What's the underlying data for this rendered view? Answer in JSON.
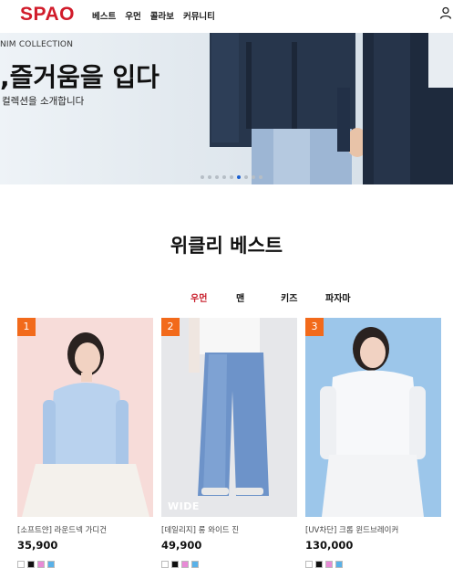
{
  "header": {
    "logo": "SPAO",
    "nav": [
      "베스트",
      "우먼",
      "콜라보",
      "커뮤니티"
    ]
  },
  "hero": {
    "subtitle": "NIM COLLECTION",
    "title": ",즐거움을 입다",
    "description": "컬렉션을 소개합니다",
    "slide_count": 9,
    "active_slide_index": 5
  },
  "weekly_best": {
    "title": "위클리 베스트",
    "tabs": [
      "우먼",
      "맨",
      "키즈",
      "파자마"
    ],
    "active_tab": "우먼"
  },
  "products": [
    {
      "rank": "1",
      "name": "[소프트얀] 라운드넥 가디건",
      "price": "35,900",
      "overlay": "",
      "swatches": [
        "#ffffff",
        "#111111",
        "#e88ad6",
        "#59b1e8"
      ]
    },
    {
      "rank": "2",
      "name": "[데일리지] 롱 와이드 진",
      "price": "49,900",
      "overlay": "WIDE",
      "swatches": [
        "#ffffff",
        "#111111",
        "#e88ad6",
        "#59b1e8"
      ]
    },
    {
      "rank": "3",
      "name": "[UV차단] 크롭 윈드브레이커",
      "price": "130,000",
      "overlay": "",
      "swatches": [
        "#ffffff",
        "#111111",
        "#e88ad6",
        "#59b1e8"
      ]
    }
  ],
  "colors": {
    "brand": "#d11b2a",
    "active_tab": "#c81e2b",
    "rank_badge": "#f26a1b",
    "active_dot": "#1a5fd0"
  }
}
